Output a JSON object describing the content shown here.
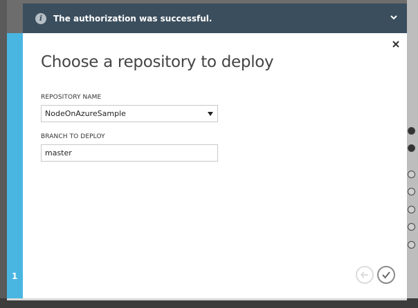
{
  "notification": {
    "message": "The authorization was successful.",
    "icon": "info-icon",
    "expand_icon": "chevron-down-icon"
  },
  "dialog": {
    "title": "Choose a repository to deploy",
    "close_icon": "close-icon",
    "step_number": "1",
    "repository": {
      "label": "REPOSITORY NAME",
      "selected": "NodeOnAzureSample"
    },
    "branch": {
      "label": "BRANCH TO DEPLOY",
      "value": "master"
    },
    "back_icon": "arrow-left-icon",
    "confirm_icon": "checkmark-icon"
  },
  "colors": {
    "accent": "#49b6e2",
    "notification_bg": "#3b4e5d",
    "overlay": "#6d6d6d"
  }
}
